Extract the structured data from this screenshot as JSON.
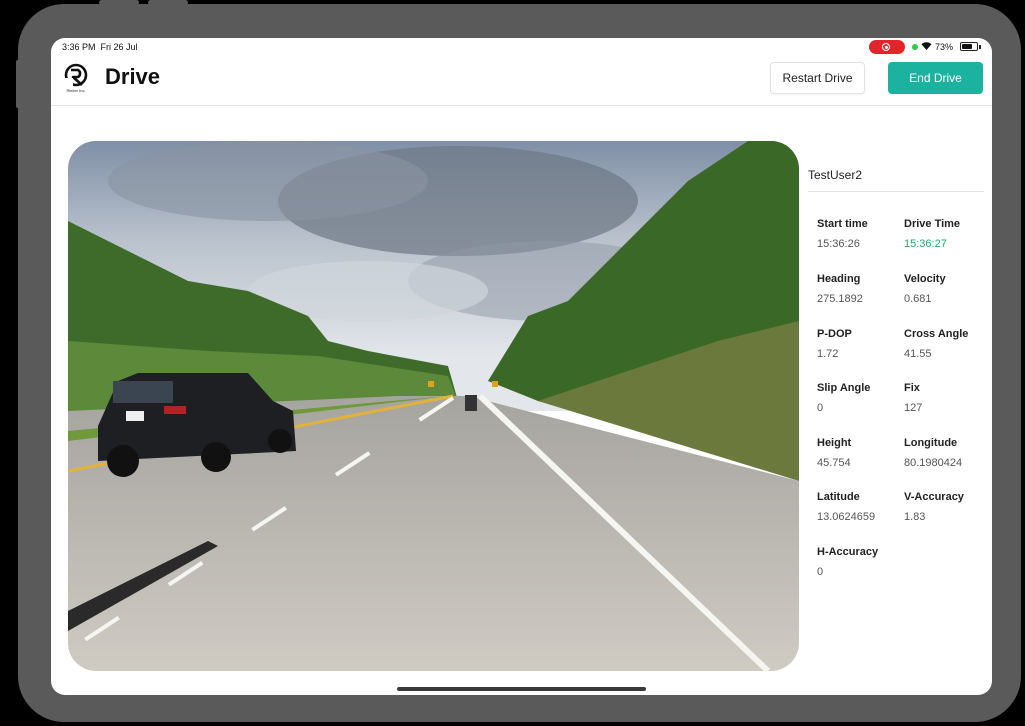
{
  "status_bar": {
    "time": "3:36 PM",
    "date": "Fri 26 Jul",
    "battery": "73%",
    "battery_level": 0.73,
    "record_color": "#e0262a"
  },
  "header": {
    "logo_caption": "Rieker Inc.",
    "title": "Drive",
    "restart_label": "Restart Drive",
    "end_label": "End Drive",
    "accent": "#1cb2a0"
  },
  "camera": {
    "description_icon": "road-photo"
  },
  "panel": {
    "username": "TestUser2",
    "fields": [
      {
        "label": "Start time",
        "value": "15:36:26"
      },
      {
        "label": "Drive Time",
        "value": "15:36:27",
        "value_color": "#23a86a"
      },
      {
        "label": "Heading",
        "value": "275.1892"
      },
      {
        "label": "Velocity",
        "value": "0.681"
      },
      {
        "label": "P-DOP",
        "value": "1.72"
      },
      {
        "label": "Cross Angle",
        "value": "41.55"
      },
      {
        "label": "Slip Angle",
        "value": "0"
      },
      {
        "label": "Fix",
        "value": "127"
      },
      {
        "label": "Height",
        "value": "45.754"
      },
      {
        "label": "Longitude",
        "value": "80.1980424"
      },
      {
        "label": "Latitude",
        "value": "13.0624659"
      },
      {
        "label": "V-Accuracy",
        "value": "1.83"
      },
      {
        "label": "H-Accuracy",
        "value": "0"
      }
    ]
  }
}
